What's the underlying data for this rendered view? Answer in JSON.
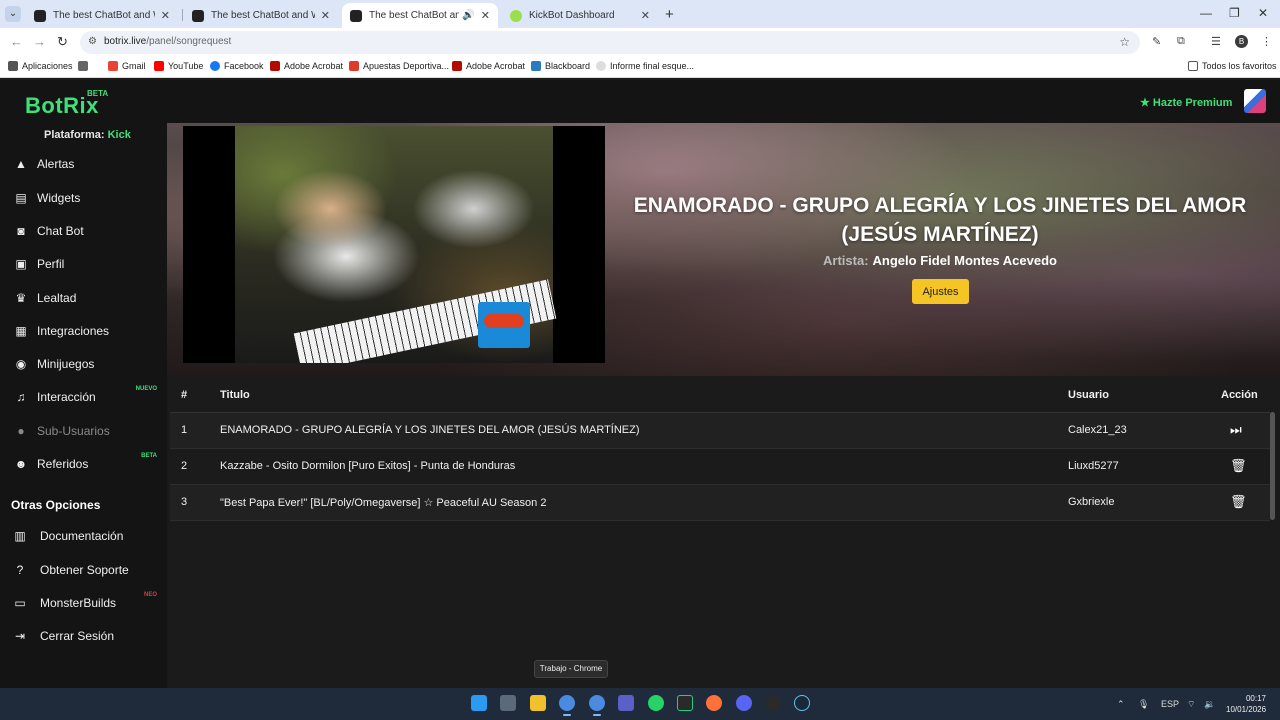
{
  "browser": {
    "tabs": [
      {
        "title": "The best ChatBot and Widgets",
        "close": "✕"
      },
      {
        "title": "The best ChatBot and Widgets",
        "close": "✕"
      },
      {
        "title": "The best ChatBot and Widg",
        "close": "✕"
      },
      {
        "title": "KickBot Dashboard",
        "close": "✕"
      }
    ],
    "url_host": "botrix.live",
    "url_path": "/panel/songrequest",
    "bookmarks": [
      "Aplicaciones",
      "Gmail",
      "YouTube",
      "Facebook",
      "Adobe Acrobat",
      "Apuestas Deportiva...",
      "Adobe Acrobat",
      "Blackboard",
      "Informe final esque...",
      "Todos los favoritos"
    ],
    "profile_initial": "B"
  },
  "header": {
    "logo": "BotRix",
    "beta": "BETA",
    "premium": "Hazte Premium"
  },
  "sidebar": {
    "platform_label": "Plataforma:",
    "platform_value": "Kick",
    "items": [
      {
        "label": "Alertas"
      },
      {
        "label": "Widgets"
      },
      {
        "label": "Chat Bot"
      },
      {
        "label": "Perfil"
      },
      {
        "label": "Lealtad"
      },
      {
        "label": "Integraciones"
      },
      {
        "label": "Minijuegos"
      },
      {
        "label": "Interacción",
        "badge": "NUEVO"
      },
      {
        "label": "Sub-Usuarios"
      },
      {
        "label": "Referidos",
        "badge": "BETA"
      }
    ],
    "section_title": "Otras Opciones",
    "other": [
      {
        "label": "Documentación"
      },
      {
        "label": "Obtener Soporte"
      },
      {
        "label": "MonsterBuilds",
        "badge": "NEO"
      },
      {
        "label": "Cerrar Sesión"
      }
    ]
  },
  "now_playing": {
    "title": "ENAMORADO - GRUPO ALEGRÍA Y LOS JINETES DEL AMOR (JESÚS MARTÍNEZ)",
    "artist_label": "Artista:",
    "artist": "Angelo Fidel Montes Acevedo",
    "settings_button": "Ajustes"
  },
  "queue": {
    "headers": {
      "num": "#",
      "title": "Titulo",
      "user": "Usuario",
      "action": "Acción"
    },
    "rows": [
      {
        "num": "1",
        "title": "ENAMORADO - GRUPO ALEGRÍA Y LOS JINETES DEL AMOR (JESÚS MARTÍNEZ)",
        "user": "Calex21_23",
        "action": "skip-icon"
      },
      {
        "num": "2",
        "title": "Kazzabe - Osito Dormilon [Puro Exitos] - Punta de Honduras",
        "user": "Liuxd5277",
        "action": "trash-icon"
      },
      {
        "num": "3",
        "title": "\"Best Papa Ever!\" [BL/Poly/Omegaverse] ☆ Peaceful AU Season 2",
        "user": "Gxbriexle",
        "action": "trash-icon"
      }
    ]
  },
  "taskbar": {
    "tooltip": "Trabajo - Chrome",
    "lang": "ESP",
    "time": "00:17",
    "date": "10/01/2026"
  },
  "colors": {
    "accent": "#3ee07a",
    "button": "#f4c524",
    "bg": "#1b1b1b"
  }
}
